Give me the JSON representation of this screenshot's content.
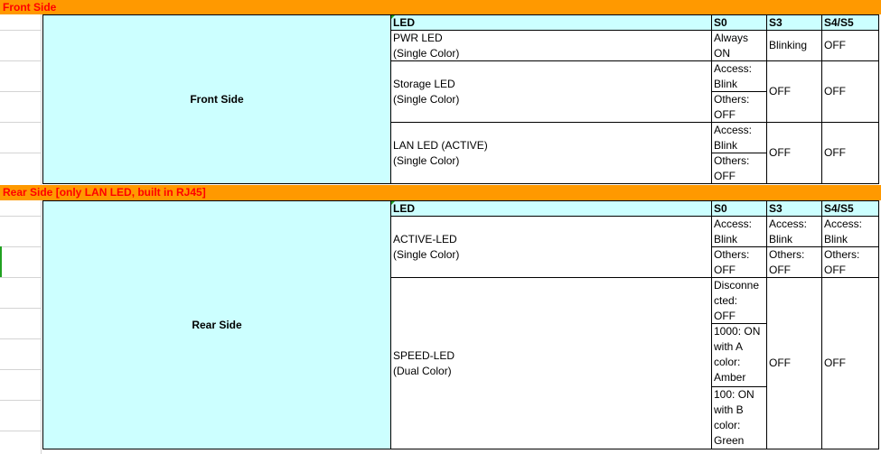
{
  "front": {
    "band_title": "Front Side",
    "section_label": "Front Side",
    "header": {
      "led": "LED",
      "s0": "S0",
      "s3": "S3",
      "s45": "S4/S5"
    },
    "rows": [
      {
        "led_l1": "PWR LED",
        "led_l2": "(Single Color)",
        "s0_l1": "Always",
        "s0_l2": "ON",
        "s3": "Blinking",
        "s45": "OFF"
      },
      {
        "led_l1": "Storage LED",
        "led_l2": "(Single Color)",
        "s0a_l1": "Access:",
        "s0a_l2": "Blink",
        "s0b_l1": "Others:",
        "s0b_l2": "OFF",
        "s3": "OFF",
        "s45": "OFF"
      },
      {
        "led_l1": "LAN LED (ACTIVE)",
        "led_l2": "(Single Color)",
        "s0a_l1": "Access:",
        "s0a_l2": "Blink",
        "s0b_l1": "Others:",
        "s0b_l2": "OFF",
        "s3": "OFF",
        "s45": "OFF"
      }
    ]
  },
  "rear": {
    "band_title": "Rear Side [only LAN LED, built in RJ45]",
    "section_label": "Rear Side",
    "header": {
      "led": "LED",
      "s0": "S0",
      "s3": "S3",
      "s45": "S4/S5"
    },
    "active": {
      "led_l1": "ACTIVE-LED",
      "led_l2": "(Single Color)",
      "s0a_l1": "Access:",
      "s0a_l2": "Blink",
      "s0b_l1": "Others:",
      "s0b_l2": "OFF",
      "s3a_l1": "Access:",
      "s3a_l2": "Blink",
      "s3b_l1": "Others:",
      "s3b_l2": "OFF",
      "s45a_l1": "Access:",
      "s45a_l2": "Blink",
      "s45b_l1": "Others:",
      "s45b_l2": "OFF"
    },
    "speed": {
      "led_l1": "SPEED-LED",
      "led_l2": "(Dual Color)",
      "s0a": [
        "Disconne",
        "cted:",
        "OFF"
      ],
      "s0b": [
        "1000: ON",
        "with A",
        "color:",
        "Amber"
      ],
      "s0c": [
        "100: ON",
        "with B",
        "color:",
        "Green"
      ],
      "s3": "OFF",
      "s45": "OFF"
    }
  }
}
